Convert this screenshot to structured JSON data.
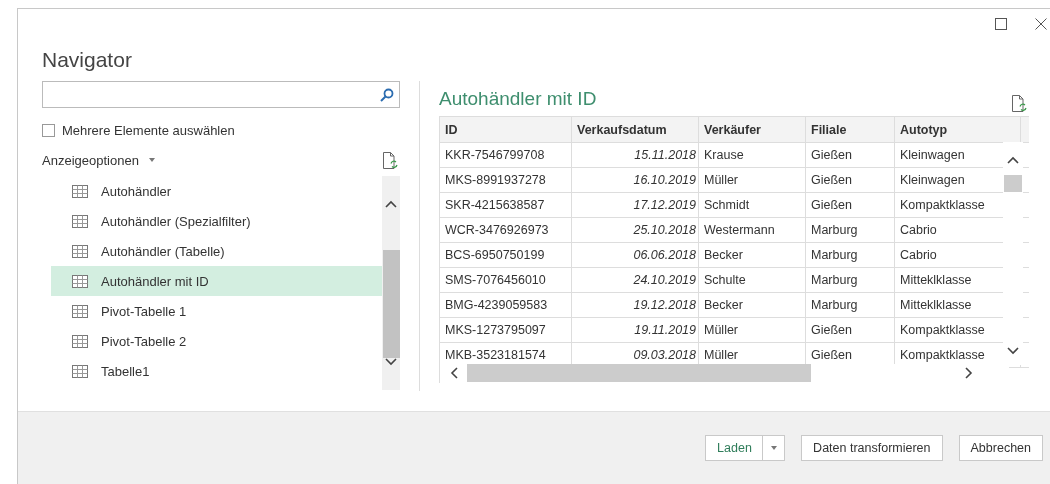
{
  "window": {
    "title": "Navigator"
  },
  "multi_select": {
    "label": "Mehrere Elemente auswählen",
    "checked": false
  },
  "display_options": {
    "label": "Anzeigeoptionen"
  },
  "items": [
    {
      "label": "Autohändler",
      "selected": false
    },
    {
      "label": "Autohändler (Spezialfilter)",
      "selected": false
    },
    {
      "label": "Autohändler (Tabelle)",
      "selected": false
    },
    {
      "label": "Autohändler mit ID",
      "selected": true
    },
    {
      "label": "Pivot-Tabelle 1",
      "selected": false
    },
    {
      "label": "Pivot-Tabelle 2",
      "selected": false
    },
    {
      "label": "Tabelle1",
      "selected": false
    }
  ],
  "preview": {
    "title": "Autohändler mit ID",
    "table": {
      "columns": [
        {
          "label": "ID",
          "kind": "text"
        },
        {
          "label": "Verkaufsdatum",
          "kind": "date"
        },
        {
          "label": "Verkäufer",
          "kind": "text"
        },
        {
          "label": "Filiale",
          "kind": "text"
        },
        {
          "label": "Autotyp",
          "kind": "text"
        }
      ],
      "rows": [
        [
          "KKR-7546799708",
          "15.11.2018",
          "Krause",
          "Gießen",
          "Kleinwagen"
        ],
        [
          "MKS-8991937278",
          "16.10.2019",
          "Müller",
          "Gießen",
          "Kleinwagen"
        ],
        [
          "SKR-4215638587",
          "17.12.2019",
          "Schmidt",
          "Gießen",
          "Kompaktklasse"
        ],
        [
          "WCR-3476926973",
          "25.10.2018",
          "Westermann",
          "Marburg",
          "Cabrio"
        ],
        [
          "BCS-6950750199",
          "06.06.2018",
          "Becker",
          "Marburg",
          "Cabrio"
        ],
        [
          "SMS-7076456010",
          "24.10.2019",
          "Schulte",
          "Marburg",
          "Mitteklklasse"
        ],
        [
          "BMG-4239059583",
          "19.12.2018",
          "Becker",
          "Marburg",
          "Mitteklklasse"
        ],
        [
          "MKS-1273795097",
          "19.11.2019",
          "Müller",
          "Gießen",
          "Kompaktklasse"
        ],
        [
          "MKB-3523181574",
          "09.03.2018",
          "Müller",
          "Gießen",
          "Kompaktklasse"
        ]
      ]
    }
  },
  "buttons": [
    {
      "label": "Laden",
      "kind": "split"
    },
    {
      "label": "Daten transformieren",
      "kind": "plain"
    },
    {
      "label": "Abbrechen",
      "kind": "plain"
    }
  ]
}
